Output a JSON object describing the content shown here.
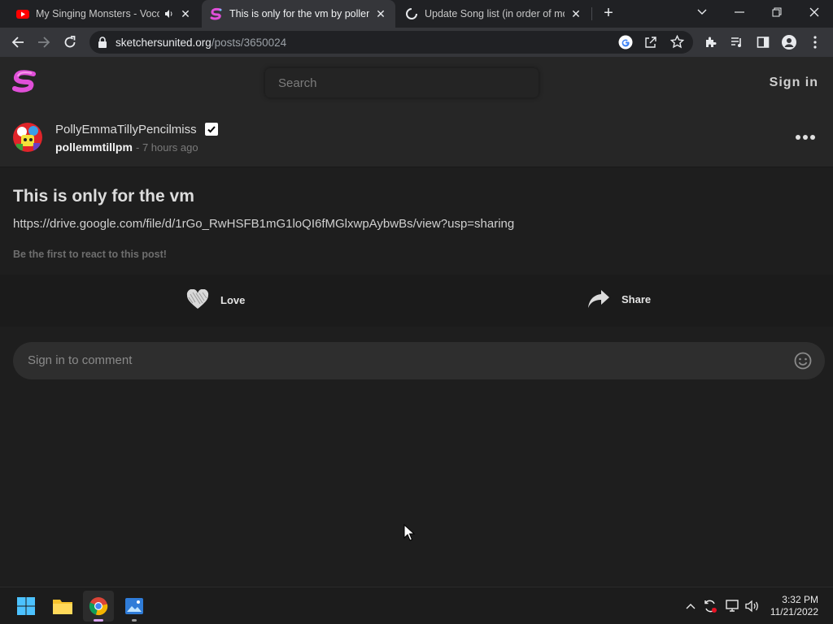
{
  "browser": {
    "tabs": [
      {
        "title": "My Singing Monsters - Voco",
        "audio": true
      },
      {
        "title": "This is only for the vm by pollemmtillpm",
        "active": true
      },
      {
        "title": "Update Song list (in order of most"
      }
    ],
    "url_domain": "sketchersunited.org",
    "url_path": "/posts/3650024"
  },
  "site": {
    "search_placeholder": "Search",
    "signin_label": "Sign in",
    "post": {
      "author_name": "PollyEmmaTillyPencilmiss",
      "author_handle": "pollemmtillpm",
      "time": "- 7 hours ago",
      "title": "This is only for the vm",
      "link": "https://drive.google.com/file/d/1rGo_RwHSFB1mG1loQI6fMGlxwpAybwBs/view?usp=sharing",
      "react_prompt": "Be the first to react to this post!",
      "love_label": "Love",
      "share_label": "Share"
    },
    "comment_placeholder": "Sign in to comment"
  },
  "taskbar": {
    "time": "3:32 PM",
    "date": "11/21/2022"
  },
  "colors": {
    "brand_pink": "#e04fd8",
    "page_bg": "#1e1e1e",
    "header_bg": "#262626"
  }
}
